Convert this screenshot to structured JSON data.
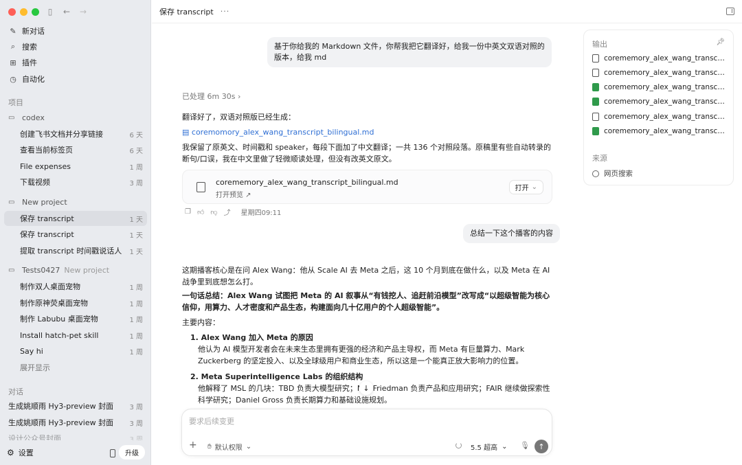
{
  "sidebar": {
    "nav": [
      {
        "label": "新对话",
        "icon": "edit-icon"
      },
      {
        "label": "搜索",
        "icon": "search-icon"
      },
      {
        "label": "插件",
        "icon": "grid-icon"
      },
      {
        "label": "自动化",
        "icon": "clock-icon"
      }
    ],
    "projects_title": "项目",
    "folder_codex": "codex",
    "codex_items": [
      {
        "label": "创建飞书文档并分享链接",
        "time": "6 天"
      },
      {
        "label": "查看当前标签页",
        "time": "6 天"
      },
      {
        "label": "File expenses",
        "time": "1 周"
      },
      {
        "label": "下载视频",
        "time": "3 周"
      }
    ],
    "folder_new_project": "New project",
    "new_project_items": [
      {
        "label": "保存 transcript",
        "time": "1 天"
      },
      {
        "label": "保存 transcript",
        "time": "1 天"
      },
      {
        "label": "提取 transcript 时间戳说话人",
        "time": "1 天"
      }
    ],
    "folder_tests": "Tests0427",
    "folder_tests_sub": "New project",
    "tests_items": [
      {
        "label": "制作双人桌面宠物",
        "time": "1 周"
      },
      {
        "label": "制作原神荧桌面宠物",
        "time": "1 周"
      },
      {
        "label": "制作 Labubu 桌面宠物",
        "time": "1 周"
      },
      {
        "label": "Install hatch-pet skill",
        "time": "1 周"
      },
      {
        "label": "Say hi",
        "time": "1 周"
      }
    ],
    "show_more": "展开显示",
    "chats_title": "对话",
    "chat_items": [
      {
        "label": "生成姚顺雨 Hy3-preview 封面",
        "time": "3 周"
      },
      {
        "label": "生成姚顺雨 Hy3-preview 封面",
        "time": "3 周"
      },
      {
        "label": "设计公众号封面",
        "time": "3 周"
      }
    ],
    "settings": "设置",
    "upgrade": "升级"
  },
  "header": {
    "title": "保存 transcript",
    "more": "···"
  },
  "chat": {
    "user_msg_1": "基于你给我的 Markdown 文件，你帮我把它翻译好，给我一份中英文双语对照的版本，给我 md",
    "processed": "已处理 6m 30s",
    "reply_1_line": "翻译好了，双语对照版已经生成：",
    "reply_1_link": "coremomory_alex_wang_transcript_bilingual.md",
    "reply_1_body": "我保留了原英文、时间戳和 speaker，每段下面加了中文翻译；一共 136 个对照段落。原稿里有些自动转录的断句/口误，我在中文里做了轻微顺读处理，但没有改英文原文。",
    "file_card": {
      "name": "corememory_alex_wang_transcript_bilingual.md",
      "sub": "打开预览 ↗",
      "open": "打开"
    },
    "timestamp": "星期四09:11",
    "user_msg_2": "总结一下这个播客的内容",
    "reply_2_intro": "这期播客核心是在问 Alex Wang：他从 Scale AI 去 Meta 之后，这 10 个月到底在做什么，以及 Meta 在 AI 战争里到底想怎么打。",
    "reply_2_summary_label": "一句话总结：",
    "reply_2_summary": "Alex Wang 试图把 Meta 的 AI 叙事从“有钱挖人、追赶前沿模型”改写成“以超级智能为核心信仰，用算力、人才密度和产品生态，构建面向几十亿用户的个人超级智能”。",
    "main_content": "主要内容：",
    "points": [
      {
        "title": "1. Alex Wang 加入 Meta 的原因",
        "body": "他认为 AI 模型开发者会在未来生态里拥有更强的经济和产品主导权，而 Meta 有巨量算力、Mark Zuckerberg 的坚定投入、以及全球级用户和商业生态，所以这是一个能真正放大影响力的位置。"
      },
      {
        "title": "2. Meta Superintelligence Labs 的组织结构",
        "body": "他解释了 MSL 的几块：TBD 负责大模型研究；Nat Friedman 负责产品和应用研究；FAIR 继续做探索性科学研究；Daniel Gross 负责长期算力和基础设施规划。"
      }
    ]
  },
  "composer": {
    "placeholder": "要求后续变更",
    "permission": "默认权限",
    "model": "5.5 超高"
  },
  "right_panel": {
    "output_title": "输出",
    "files": [
      {
        "name": "corememory_alex_wang_transcript...",
        "type": "doc"
      },
      {
        "name": "corememory_alex_wang_transcript...",
        "type": "doc"
      },
      {
        "name": "corememory_alex_wang_transcript...",
        "type": "sheet"
      },
      {
        "name": "corememory_alex_wang_transcript...",
        "type": "sheet"
      },
      {
        "name": "corememory_alex_wang_transcript...",
        "type": "doc"
      },
      {
        "name": "corememory_alex_wang_transcript...",
        "type": "sheet"
      }
    ],
    "source_title": "来源",
    "web_search": "网页搜索"
  },
  "colors": {
    "accent_link": "#2f6fd4",
    "sheet_icon": "#2f9a4b"
  }
}
